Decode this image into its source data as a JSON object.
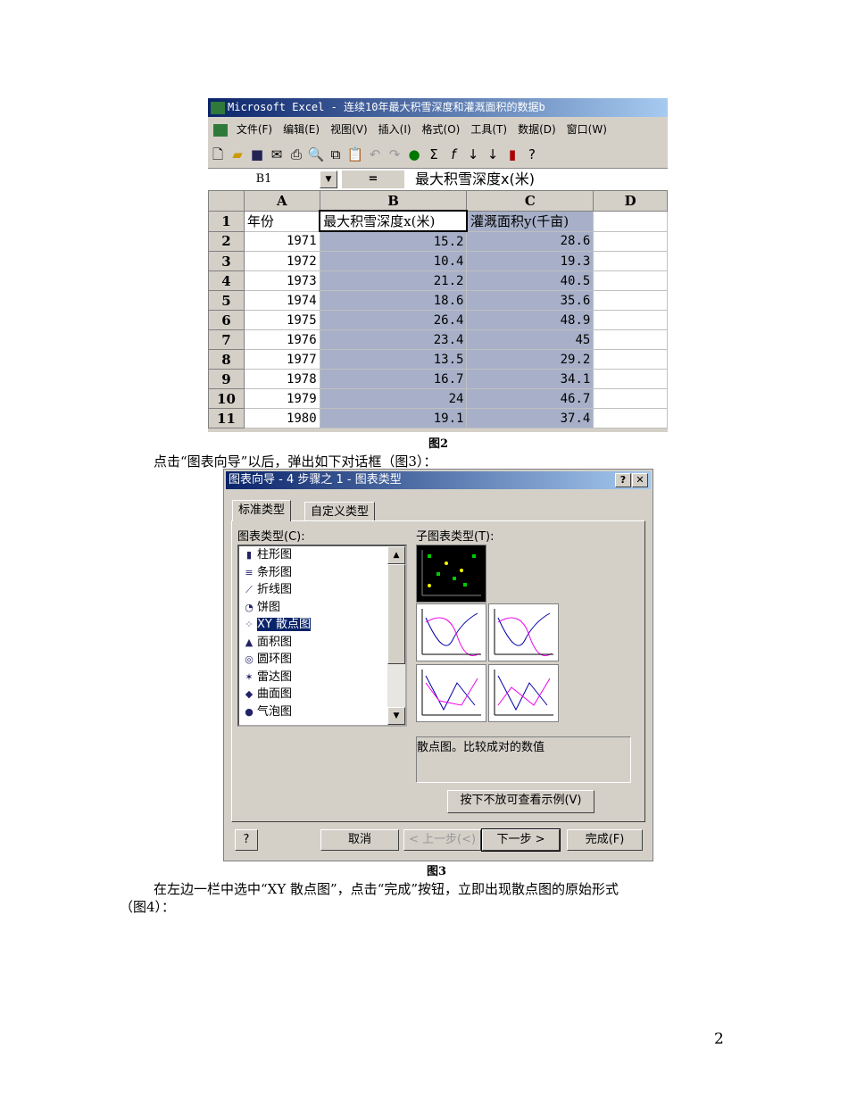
{
  "excel": {
    "title": "Microsoft Excel - 连续10年最大积雪深度和灌溉面积的数据b",
    "menu": [
      "文件(F)",
      "编辑(E)",
      "视图(V)",
      "插入(I)",
      "格式(O)",
      "工具(T)",
      "数据(D)",
      "窗口(W)"
    ],
    "name_box": "B1",
    "formula_eq": "=",
    "formula": "最大积雪深度x(米)",
    "columns": [
      "A",
      "B",
      "C",
      "D"
    ],
    "rows": [
      {
        "n": "1",
        "a": "年份",
        "b": "最大积雪深度x(米)",
        "c": "灌溉面积y(千亩)"
      },
      {
        "n": "2",
        "a": "1971",
        "b": "15.2",
        "c": "28.6"
      },
      {
        "n": "3",
        "a": "1972",
        "b": "10.4",
        "c": "19.3"
      },
      {
        "n": "4",
        "a": "1973",
        "b": "21.2",
        "c": "40.5"
      },
      {
        "n": "5",
        "a": "1974",
        "b": "18.6",
        "c": "35.6"
      },
      {
        "n": "6",
        "a": "1975",
        "b": "26.4",
        "c": "48.9"
      },
      {
        "n": "7",
        "a": "1976",
        "b": "23.4",
        "c": "45"
      },
      {
        "n": "8",
        "a": "1977",
        "b": "13.5",
        "c": "29.2"
      },
      {
        "n": "9",
        "a": "1978",
        "b": "16.7",
        "c": "34.1"
      },
      {
        "n": "10",
        "a": "1979",
        "b": "24",
        "c": "46.7"
      },
      {
        "n": "11",
        "a": "1980",
        "b": "19.1",
        "c": "37.4"
      }
    ]
  },
  "caption2": "图2",
  "text1": "点击“图表向导”以后，弹出如下对话框（图3）：",
  "dialog": {
    "title": "图表向导 - 4 步骤之 1 - 图表类型",
    "help": "?",
    "close": "✕",
    "tabs": [
      "标准类型",
      "自定义类型"
    ],
    "chart_type_label": "图表类型(C):",
    "sub_type_label": "子图表类型(T):",
    "types": [
      "柱形图",
      "条形图",
      "折线图",
      "饼图",
      "XY 散点图",
      "面积图",
      "圆环图",
      "雷达图",
      "曲面图",
      "气泡图"
    ],
    "description": "散点图。比较成对的数值",
    "preview_button": "按下不放可查看示例(V)",
    "cancel": "取消",
    "back": "< 上一步(<)",
    "next": "下一步 >",
    "finish": "完成(F)"
  },
  "caption3": "图3",
  "text2": "在左边一栏中选中“XY 散点图”，点击“完成”按钮，立即出现散点图的原始形式",
  "text3": "（图4）：",
  "page_number": "2"
}
